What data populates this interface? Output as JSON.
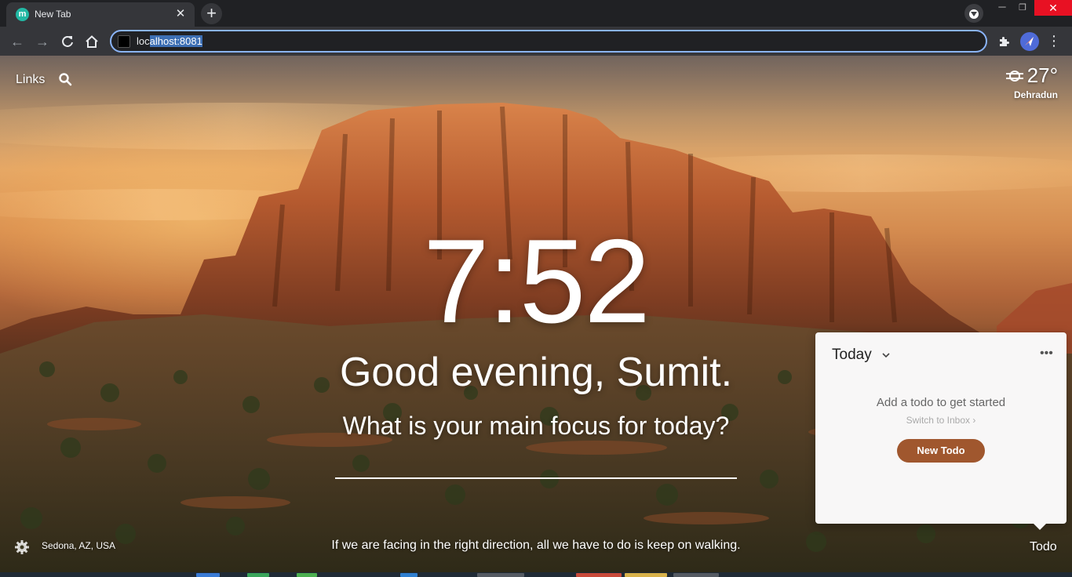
{
  "browser": {
    "tab_title": "New Tab",
    "tab_favicon_letter": "m",
    "url_plain": "loc",
    "url_selected": "alhost:8081"
  },
  "page": {
    "links_label": "Links",
    "weather": {
      "temperature": "27°",
      "location": "Dehradun",
      "icon": "haze-icon"
    },
    "clock": "7:52",
    "greeting": "Good evening, Sumit.",
    "focus_question": "What is your main focus for today?",
    "focus_value": "",
    "photo_location": "Sedona, AZ, USA",
    "quote": "If we are facing in the right direction, all we have to do is keep on walking.",
    "todo_toggle_label": "Todo"
  },
  "todo": {
    "list_name": "Today",
    "empty_message": "Add a todo to get started",
    "switch_label": "Switch to Inbox",
    "new_button_label": "New Todo",
    "accent_color": "#a0572e"
  }
}
